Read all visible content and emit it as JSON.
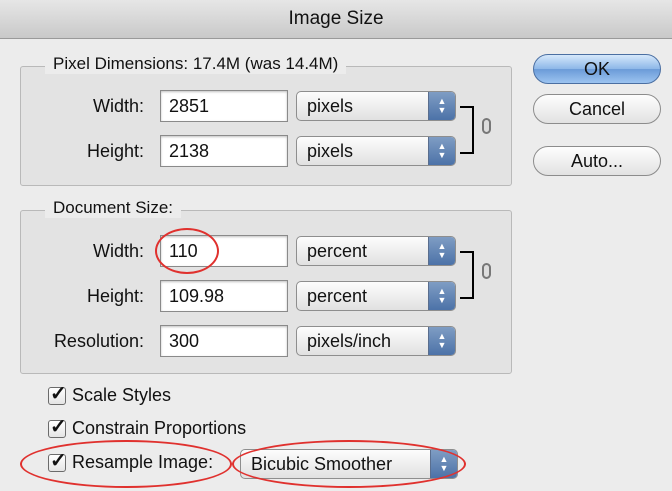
{
  "window": {
    "title": "Image Size"
  },
  "pixel_dimensions": {
    "legend": "Pixel Dimensions:  17.4M (was 14.4M)",
    "width_label": "Width:",
    "width_value": "2851",
    "width_unit": "pixels",
    "height_label": "Height:",
    "height_value": "2138",
    "height_unit": "pixels"
  },
  "document_size": {
    "legend": "Document Size:",
    "width_label": "Width:",
    "width_value": "110",
    "width_unit": "percent",
    "height_label": "Height:",
    "height_value": "109.98",
    "height_unit": "percent",
    "resolution_label": "Resolution:",
    "resolution_value": "300",
    "resolution_unit": "pixels/inch"
  },
  "buttons": {
    "ok": "OK",
    "cancel": "Cancel",
    "auto": "Auto..."
  },
  "options": {
    "scale_styles": {
      "label": "Scale Styles",
      "checked": true
    },
    "constrain": {
      "label": "Constrain Proportions",
      "checked": true
    },
    "resample": {
      "label": "Resample Image:",
      "checked": true
    },
    "resample_method": "Bicubic Smoother"
  },
  "annotations": {
    "highlight_color": "#e0312e"
  }
}
